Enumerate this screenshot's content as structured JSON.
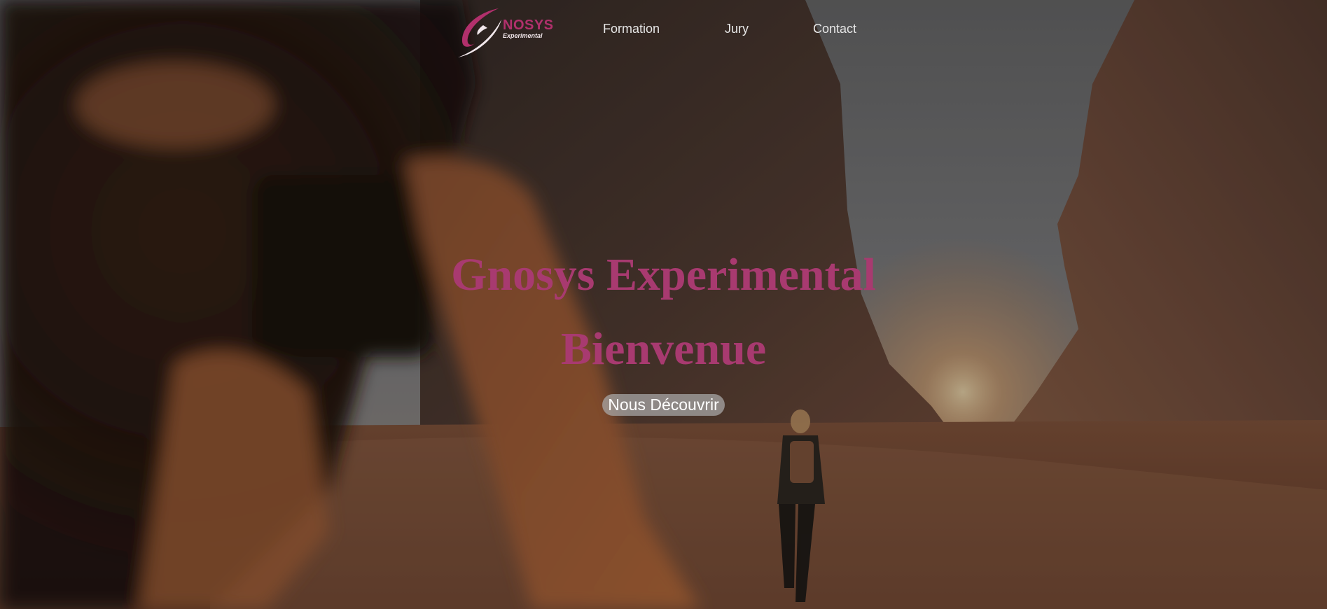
{
  "brand": {
    "logo_word": "NOSYS",
    "logo_sub": "Experimental",
    "logo_color": "#b1306c"
  },
  "nav": {
    "items": [
      {
        "label": "Formation"
      },
      {
        "label": "Jury"
      },
      {
        "label": "Contact"
      }
    ]
  },
  "hero": {
    "title": "Gnosys Experimental",
    "subtitle": "Bienvenue",
    "cta_label": "Nous Découvrir",
    "title_color": "#a83a70",
    "background_image": "photographer-in-desert-canyon"
  }
}
